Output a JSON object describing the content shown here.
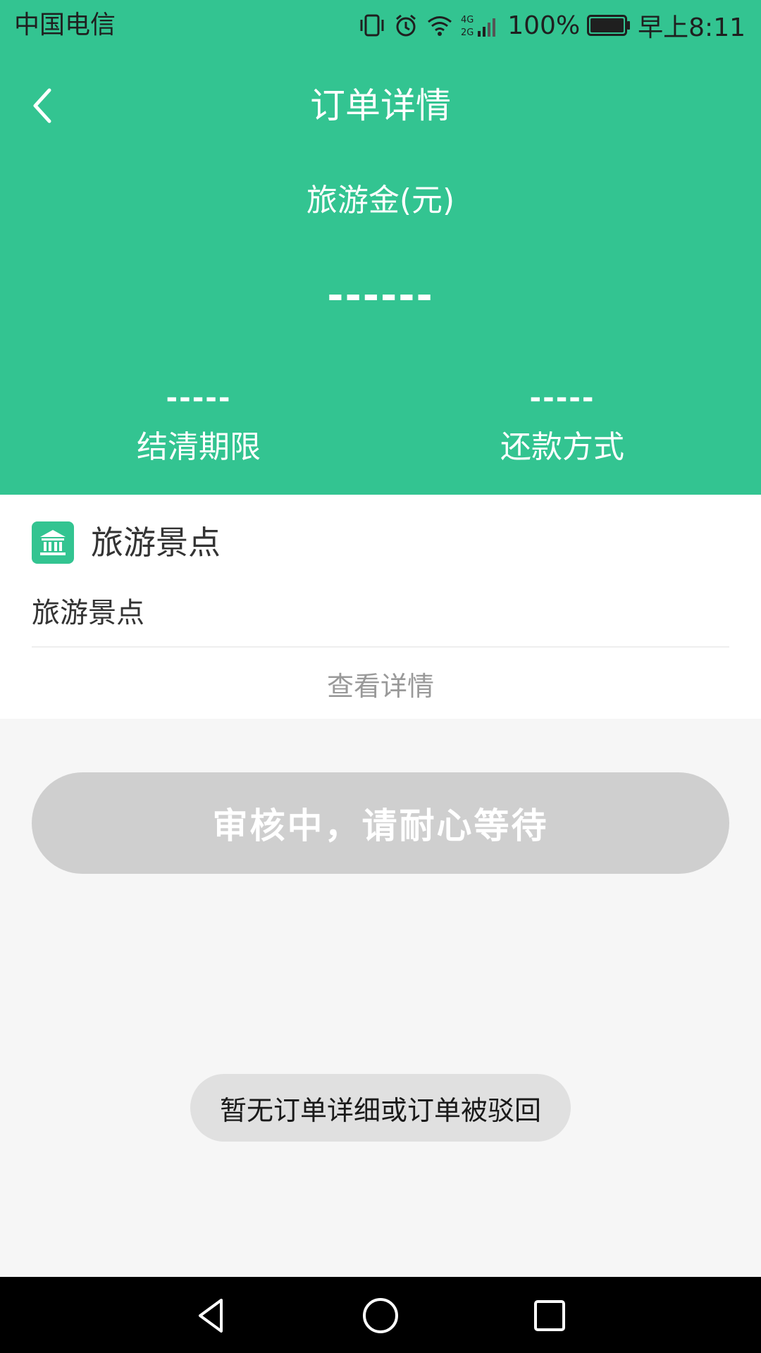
{
  "status_bar": {
    "carrier": "中国电信",
    "network": "4G 2G",
    "battery": "100%",
    "time": "早上8:11",
    "icons": [
      "vibrate-icon",
      "alarm-icon",
      "wifi-icon",
      "signal-icon",
      "battery-icon"
    ]
  },
  "header": {
    "back_icon": "back-arrow-icon",
    "title": "订单详情",
    "amount_label": "旅游金(元)",
    "amount_value": "------",
    "stats": [
      {
        "value": "-----",
        "label": "结清期限"
      },
      {
        "value": "-----",
        "label": "还款方式"
      }
    ],
    "bg_color": "#33c491"
  },
  "card": {
    "icon": "museum-icon",
    "title": "旅游景点",
    "subtitle": "旅游景点",
    "view_detail": "查看详情"
  },
  "action": {
    "review_button": "审核中，请耐心等待",
    "button_color": "#cfcfcf"
  },
  "toast": {
    "message": "暂无订单详细或订单被驳回"
  },
  "nav_bar": {
    "buttons": [
      "back-triangle-icon",
      "home-circle-icon",
      "recent-square-icon"
    ]
  }
}
